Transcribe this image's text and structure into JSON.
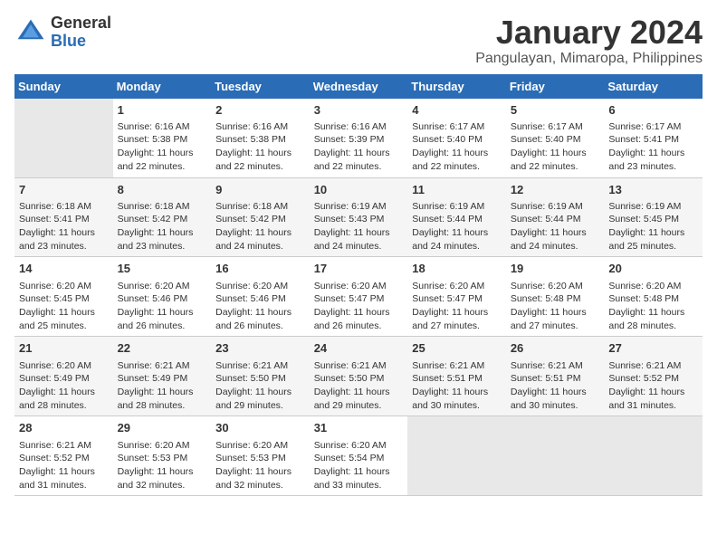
{
  "logo": {
    "general": "General",
    "blue": "Blue"
  },
  "title": {
    "main": "January 2024",
    "sub": "Pangulayan, Mimaropa, Philippines"
  },
  "weekdays": [
    "Sunday",
    "Monday",
    "Tuesday",
    "Wednesday",
    "Thursday",
    "Friday",
    "Saturday"
  ],
  "rows": [
    [
      {
        "num": "",
        "info": ""
      },
      {
        "num": "1",
        "info": "Sunrise: 6:16 AM\nSunset: 5:38 PM\nDaylight: 11 hours\nand 22 minutes."
      },
      {
        "num": "2",
        "info": "Sunrise: 6:16 AM\nSunset: 5:38 PM\nDaylight: 11 hours\nand 22 minutes."
      },
      {
        "num": "3",
        "info": "Sunrise: 6:16 AM\nSunset: 5:39 PM\nDaylight: 11 hours\nand 22 minutes."
      },
      {
        "num": "4",
        "info": "Sunrise: 6:17 AM\nSunset: 5:40 PM\nDaylight: 11 hours\nand 22 minutes."
      },
      {
        "num": "5",
        "info": "Sunrise: 6:17 AM\nSunset: 5:40 PM\nDaylight: 11 hours\nand 22 minutes."
      },
      {
        "num": "6",
        "info": "Sunrise: 6:17 AM\nSunset: 5:41 PM\nDaylight: 11 hours\nand 23 minutes."
      }
    ],
    [
      {
        "num": "7",
        "info": "Sunrise: 6:18 AM\nSunset: 5:41 PM\nDaylight: 11 hours\nand 23 minutes."
      },
      {
        "num": "8",
        "info": "Sunrise: 6:18 AM\nSunset: 5:42 PM\nDaylight: 11 hours\nand 23 minutes."
      },
      {
        "num": "9",
        "info": "Sunrise: 6:18 AM\nSunset: 5:42 PM\nDaylight: 11 hours\nand 24 minutes."
      },
      {
        "num": "10",
        "info": "Sunrise: 6:19 AM\nSunset: 5:43 PM\nDaylight: 11 hours\nand 24 minutes."
      },
      {
        "num": "11",
        "info": "Sunrise: 6:19 AM\nSunset: 5:44 PM\nDaylight: 11 hours\nand 24 minutes."
      },
      {
        "num": "12",
        "info": "Sunrise: 6:19 AM\nSunset: 5:44 PM\nDaylight: 11 hours\nand 24 minutes."
      },
      {
        "num": "13",
        "info": "Sunrise: 6:19 AM\nSunset: 5:45 PM\nDaylight: 11 hours\nand 25 minutes."
      }
    ],
    [
      {
        "num": "14",
        "info": "Sunrise: 6:20 AM\nSunset: 5:45 PM\nDaylight: 11 hours\nand 25 minutes."
      },
      {
        "num": "15",
        "info": "Sunrise: 6:20 AM\nSunset: 5:46 PM\nDaylight: 11 hours\nand 26 minutes."
      },
      {
        "num": "16",
        "info": "Sunrise: 6:20 AM\nSunset: 5:46 PM\nDaylight: 11 hours\nand 26 minutes."
      },
      {
        "num": "17",
        "info": "Sunrise: 6:20 AM\nSunset: 5:47 PM\nDaylight: 11 hours\nand 26 minutes."
      },
      {
        "num": "18",
        "info": "Sunrise: 6:20 AM\nSunset: 5:47 PM\nDaylight: 11 hours\nand 27 minutes."
      },
      {
        "num": "19",
        "info": "Sunrise: 6:20 AM\nSunset: 5:48 PM\nDaylight: 11 hours\nand 27 minutes."
      },
      {
        "num": "20",
        "info": "Sunrise: 6:20 AM\nSunset: 5:48 PM\nDaylight: 11 hours\nand 28 minutes."
      }
    ],
    [
      {
        "num": "21",
        "info": "Sunrise: 6:20 AM\nSunset: 5:49 PM\nDaylight: 11 hours\nand 28 minutes."
      },
      {
        "num": "22",
        "info": "Sunrise: 6:21 AM\nSunset: 5:49 PM\nDaylight: 11 hours\nand 28 minutes."
      },
      {
        "num": "23",
        "info": "Sunrise: 6:21 AM\nSunset: 5:50 PM\nDaylight: 11 hours\nand 29 minutes."
      },
      {
        "num": "24",
        "info": "Sunrise: 6:21 AM\nSunset: 5:50 PM\nDaylight: 11 hours\nand 29 minutes."
      },
      {
        "num": "25",
        "info": "Sunrise: 6:21 AM\nSunset: 5:51 PM\nDaylight: 11 hours\nand 30 minutes."
      },
      {
        "num": "26",
        "info": "Sunrise: 6:21 AM\nSunset: 5:51 PM\nDaylight: 11 hours\nand 30 minutes."
      },
      {
        "num": "27",
        "info": "Sunrise: 6:21 AM\nSunset: 5:52 PM\nDaylight: 11 hours\nand 31 minutes."
      }
    ],
    [
      {
        "num": "28",
        "info": "Sunrise: 6:21 AM\nSunset: 5:52 PM\nDaylight: 11 hours\nand 31 minutes."
      },
      {
        "num": "29",
        "info": "Sunrise: 6:20 AM\nSunset: 5:53 PM\nDaylight: 11 hours\nand 32 minutes."
      },
      {
        "num": "30",
        "info": "Sunrise: 6:20 AM\nSunset: 5:53 PM\nDaylight: 11 hours\nand 32 minutes."
      },
      {
        "num": "31",
        "info": "Sunrise: 6:20 AM\nSunset: 5:54 PM\nDaylight: 11 hours\nand 33 minutes."
      },
      {
        "num": "",
        "info": ""
      },
      {
        "num": "",
        "info": ""
      },
      {
        "num": "",
        "info": ""
      }
    ]
  ]
}
